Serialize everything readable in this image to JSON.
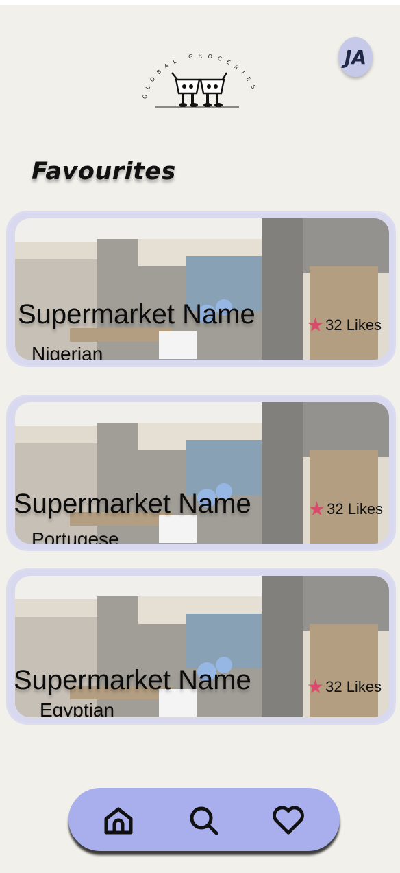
{
  "app": {
    "logo_text": "GLOBAL GROCERIES",
    "avatar_initials": "JA"
  },
  "page": {
    "title": "Favourites"
  },
  "favourites": [
    {
      "name": "Supermarket Name",
      "cuisine": "Nigerian",
      "likes": "32 Likes"
    },
    {
      "name": "Supermarket Name",
      "cuisine": "Portugese",
      "likes": "32 Likes"
    },
    {
      "name": "Supermarket Name",
      "cuisine": "Egyptian",
      "likes": "32 Likes"
    }
  ],
  "nav": {
    "items": [
      "home-icon",
      "search-icon",
      "heart-icon"
    ]
  },
  "colors": {
    "background": "#f1f0ea",
    "accent": "#a9aeec",
    "star": "#d94a6c",
    "avatar": "#c6cae8"
  }
}
